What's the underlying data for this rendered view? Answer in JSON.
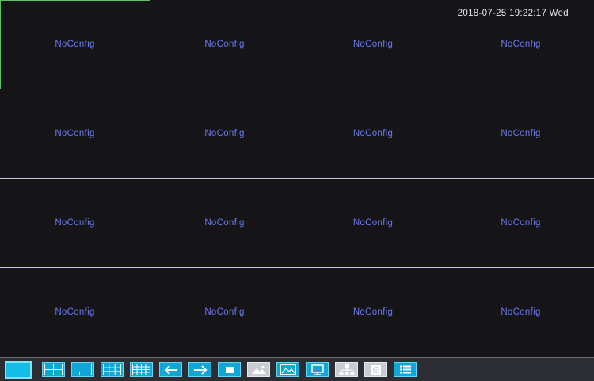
{
  "datetime": "2018-07-25 19:22:17 Wed",
  "channels": [
    {
      "label": "NoConfig"
    },
    {
      "label": "NoConfig"
    },
    {
      "label": "NoConfig"
    },
    {
      "label": "NoConfig"
    },
    {
      "label": "NoConfig"
    },
    {
      "label": "NoConfig"
    },
    {
      "label": "NoConfig"
    },
    {
      "label": "NoConfig"
    },
    {
      "label": "NoConfig"
    },
    {
      "label": "NoConfig"
    },
    {
      "label": "NoConfig"
    },
    {
      "label": "NoConfig"
    },
    {
      "label": "NoConfig"
    },
    {
      "label": "NoConfig"
    },
    {
      "label": "NoConfig"
    },
    {
      "label": "NoConfig"
    }
  ],
  "selected_channel": 1,
  "toolbar": {
    "buttons": [
      {
        "icon": "single-view-icon",
        "state": "active"
      },
      {
        "icon": "quad-view-icon",
        "state": "normal"
      },
      {
        "icon": "six-split-view-icon",
        "state": "normal"
      },
      {
        "icon": "nine-split-view-icon",
        "state": "normal"
      },
      {
        "icon": "sixteen-split-view-icon",
        "state": "normal"
      },
      {
        "icon": "arrow-left-icon",
        "state": "normal"
      },
      {
        "icon": "arrow-right-icon",
        "state": "normal"
      },
      {
        "icon": "stop-icon",
        "state": "normal"
      },
      {
        "icon": "image-adjust-icon",
        "state": "disabled"
      },
      {
        "icon": "picture-icon",
        "state": "normal"
      },
      {
        "icon": "monitor-icon",
        "state": "normal"
      },
      {
        "icon": "network-icon",
        "state": "disabled"
      },
      {
        "icon": "disk-icon",
        "state": "disabled"
      },
      {
        "icon": "menu-list-icon",
        "state": "normal"
      }
    ]
  },
  "colors": {
    "accent": "#10a7d7",
    "channel_label": "#6a78ee",
    "grid_line": "#c9c3e6",
    "selection": "#59c26a"
  }
}
